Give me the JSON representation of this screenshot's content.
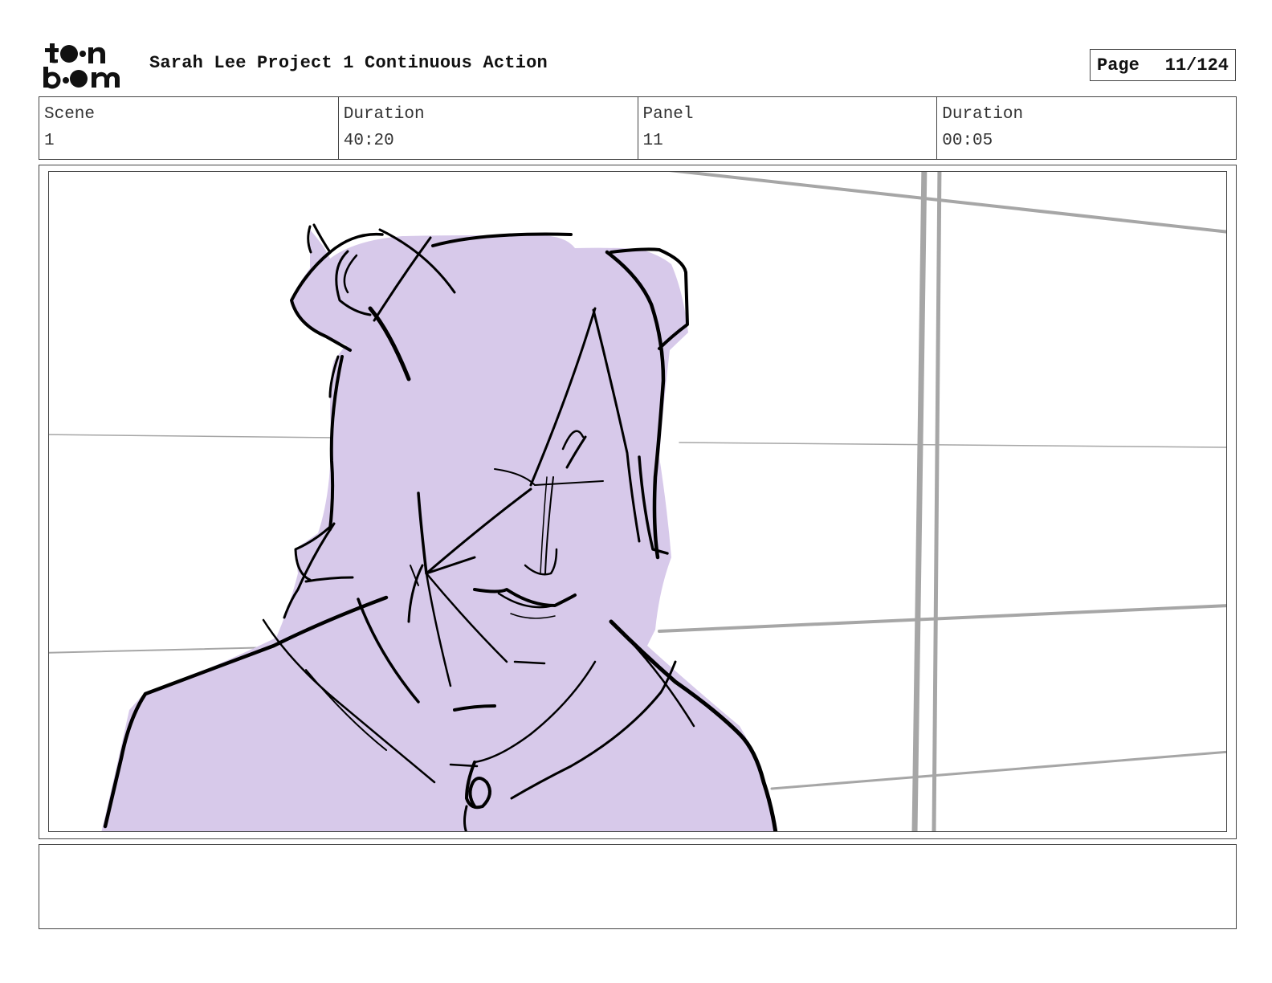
{
  "header": {
    "logo_text": "toon boom",
    "project_title": "Sarah Lee Project 1 Continuous Action",
    "page_label": "Page",
    "page_value": "11/124"
  },
  "info": {
    "scene_label": "Scene",
    "scene_value": "1",
    "scene_duration_label": "Duration",
    "scene_duration_value": "40:20",
    "panel_label": "Panel",
    "panel_value": "11",
    "panel_duration_label": "Duration",
    "panel_duration_value": "00:05"
  },
  "panel": {
    "fill_color": "#d7c9ea",
    "line_color": "#000000",
    "background_lines_color": "#a6a6a6"
  },
  "notes": {
    "text": ""
  }
}
